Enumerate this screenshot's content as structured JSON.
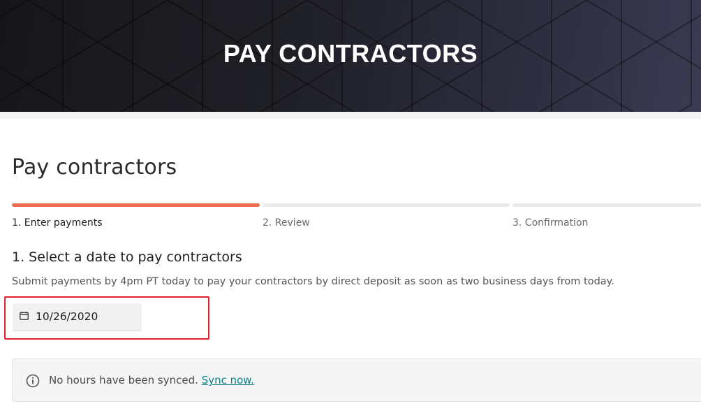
{
  "banner": {
    "title": "PAY CONTRACTORS"
  },
  "page": {
    "title": "Pay contractors"
  },
  "steps": [
    {
      "label": "1. Enter payments",
      "active": true
    },
    {
      "label": "2. Review",
      "active": false
    },
    {
      "label": "3. Confirmation",
      "active": false
    }
  ],
  "section": {
    "title": "1. Select a date to pay contractors",
    "description": "Submit payments by 4pm PT today to pay your contractors by direct deposit as soon as two business days from today."
  },
  "date_picker": {
    "icon": "calendar-icon",
    "value": "10/26/2020"
  },
  "notice": {
    "icon": "info-icon",
    "message": "No hours have been synced.",
    "link_label": "Sync now."
  },
  "colors": {
    "accent": "#ee6d4f",
    "highlight": "#e0202a",
    "link": "#0d7c8c"
  }
}
